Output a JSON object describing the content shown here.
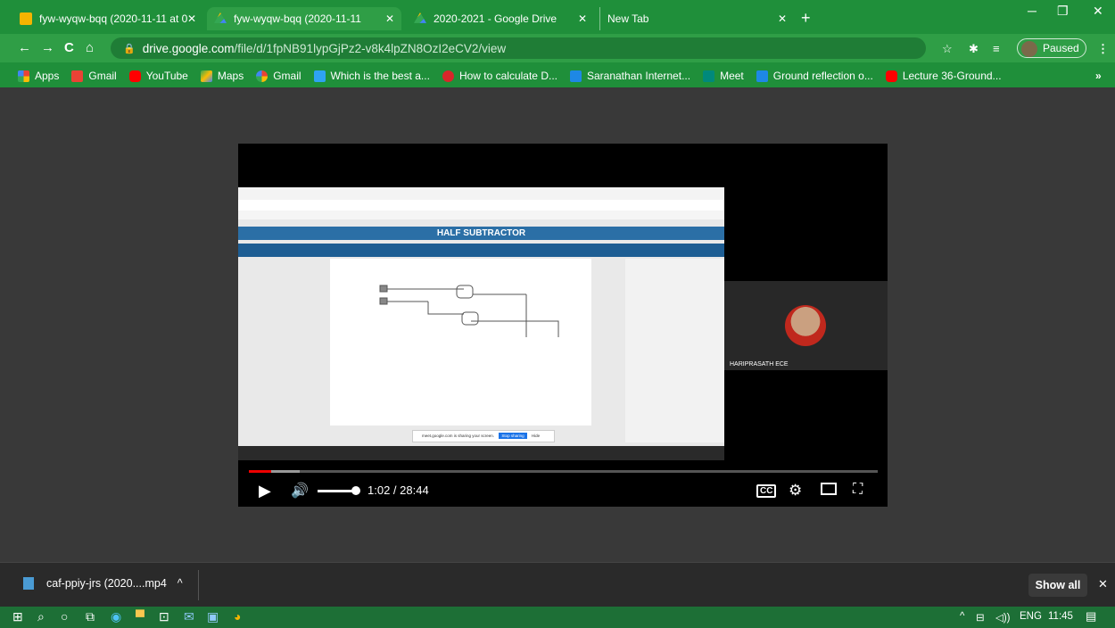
{
  "tabs": [
    {
      "label": "fyw-wyqw-bqq (2020-11-11 at 0",
      "active": false
    },
    {
      "label": "fyw-wyqw-bqq (2020-11-11",
      "active": true
    },
    {
      "label": "2020-2021 - Google Drive",
      "active": false
    },
    {
      "label": "New Tab",
      "active": false
    }
  ],
  "address": {
    "host": "drive.google.com",
    "path": "/file/d/1fpNB91lypGjPz2-v8k4lpZN8OzI2eCV2/view"
  },
  "profile": {
    "label": "Paused"
  },
  "bookmarks": [
    {
      "label": "Apps",
      "color": "#ea4335"
    },
    {
      "label": "Gmail",
      "color": "#ea4335"
    },
    {
      "label": "YouTube",
      "color": "#ff0000"
    },
    {
      "label": "Maps",
      "color": "#34a853"
    },
    {
      "label": "Gmail",
      "color": "#4285f4"
    },
    {
      "label": "Which is the best a...",
      "color": "#2ea3f2"
    },
    {
      "label": "How to calculate D...",
      "color": "#d9262a"
    },
    {
      "label": "Saranathan Internet...",
      "color": "#1e88e5"
    },
    {
      "label": "Meet",
      "color": "#00897b"
    },
    {
      "label": "Ground reflection o...",
      "color": "#1e88e5"
    },
    {
      "label": "Lecture 36-Ground...",
      "color": "#ff0000"
    }
  ],
  "video": {
    "time": "1:02 / 28:44",
    "participant": "HARIPRASATH ECE",
    "inner_title": "HALF SUBTRACTOR",
    "inner_share_text": "meet.google.com is sharing your screen.",
    "inner_stop": "Stop sharing",
    "inner_hide": "Hide",
    "progress_fraction": 0.036
  },
  "download": {
    "filename": "caf-ppiy-jrs (2020....mp4",
    "show_all": "Show all"
  },
  "taskbar": {
    "lang": "ENG",
    "clock": "11:45"
  }
}
